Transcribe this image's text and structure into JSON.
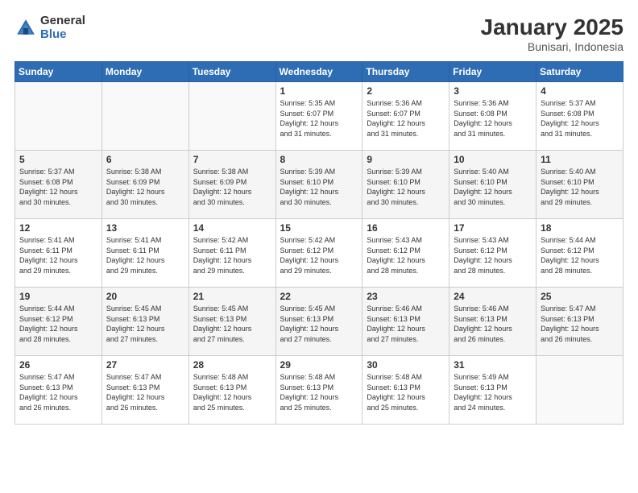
{
  "logo": {
    "general": "General",
    "blue": "Blue"
  },
  "title": "January 2025",
  "subtitle": "Bunisari, Indonesia",
  "headers": [
    "Sunday",
    "Monday",
    "Tuesday",
    "Wednesday",
    "Thursday",
    "Friday",
    "Saturday"
  ],
  "weeks": [
    [
      {
        "num": "",
        "info": ""
      },
      {
        "num": "",
        "info": ""
      },
      {
        "num": "",
        "info": ""
      },
      {
        "num": "1",
        "info": "Sunrise: 5:35 AM\nSunset: 6:07 PM\nDaylight: 12 hours\nand 31 minutes."
      },
      {
        "num": "2",
        "info": "Sunrise: 5:36 AM\nSunset: 6:07 PM\nDaylight: 12 hours\nand 31 minutes."
      },
      {
        "num": "3",
        "info": "Sunrise: 5:36 AM\nSunset: 6:08 PM\nDaylight: 12 hours\nand 31 minutes."
      },
      {
        "num": "4",
        "info": "Sunrise: 5:37 AM\nSunset: 6:08 PM\nDaylight: 12 hours\nand 31 minutes."
      }
    ],
    [
      {
        "num": "5",
        "info": "Sunrise: 5:37 AM\nSunset: 6:08 PM\nDaylight: 12 hours\nand 30 minutes."
      },
      {
        "num": "6",
        "info": "Sunrise: 5:38 AM\nSunset: 6:09 PM\nDaylight: 12 hours\nand 30 minutes."
      },
      {
        "num": "7",
        "info": "Sunrise: 5:38 AM\nSunset: 6:09 PM\nDaylight: 12 hours\nand 30 minutes."
      },
      {
        "num": "8",
        "info": "Sunrise: 5:39 AM\nSunset: 6:10 PM\nDaylight: 12 hours\nand 30 minutes."
      },
      {
        "num": "9",
        "info": "Sunrise: 5:39 AM\nSunset: 6:10 PM\nDaylight: 12 hours\nand 30 minutes."
      },
      {
        "num": "10",
        "info": "Sunrise: 5:40 AM\nSunset: 6:10 PM\nDaylight: 12 hours\nand 30 minutes."
      },
      {
        "num": "11",
        "info": "Sunrise: 5:40 AM\nSunset: 6:10 PM\nDaylight: 12 hours\nand 29 minutes."
      }
    ],
    [
      {
        "num": "12",
        "info": "Sunrise: 5:41 AM\nSunset: 6:11 PM\nDaylight: 12 hours\nand 29 minutes."
      },
      {
        "num": "13",
        "info": "Sunrise: 5:41 AM\nSunset: 6:11 PM\nDaylight: 12 hours\nand 29 minutes."
      },
      {
        "num": "14",
        "info": "Sunrise: 5:42 AM\nSunset: 6:11 PM\nDaylight: 12 hours\nand 29 minutes."
      },
      {
        "num": "15",
        "info": "Sunrise: 5:42 AM\nSunset: 6:12 PM\nDaylight: 12 hours\nand 29 minutes."
      },
      {
        "num": "16",
        "info": "Sunrise: 5:43 AM\nSunset: 6:12 PM\nDaylight: 12 hours\nand 28 minutes."
      },
      {
        "num": "17",
        "info": "Sunrise: 5:43 AM\nSunset: 6:12 PM\nDaylight: 12 hours\nand 28 minutes."
      },
      {
        "num": "18",
        "info": "Sunrise: 5:44 AM\nSunset: 6:12 PM\nDaylight: 12 hours\nand 28 minutes."
      }
    ],
    [
      {
        "num": "19",
        "info": "Sunrise: 5:44 AM\nSunset: 6:12 PM\nDaylight: 12 hours\nand 28 minutes."
      },
      {
        "num": "20",
        "info": "Sunrise: 5:45 AM\nSunset: 6:13 PM\nDaylight: 12 hours\nand 27 minutes."
      },
      {
        "num": "21",
        "info": "Sunrise: 5:45 AM\nSunset: 6:13 PM\nDaylight: 12 hours\nand 27 minutes."
      },
      {
        "num": "22",
        "info": "Sunrise: 5:45 AM\nSunset: 6:13 PM\nDaylight: 12 hours\nand 27 minutes."
      },
      {
        "num": "23",
        "info": "Sunrise: 5:46 AM\nSunset: 6:13 PM\nDaylight: 12 hours\nand 27 minutes."
      },
      {
        "num": "24",
        "info": "Sunrise: 5:46 AM\nSunset: 6:13 PM\nDaylight: 12 hours\nand 26 minutes."
      },
      {
        "num": "25",
        "info": "Sunrise: 5:47 AM\nSunset: 6:13 PM\nDaylight: 12 hours\nand 26 minutes."
      }
    ],
    [
      {
        "num": "26",
        "info": "Sunrise: 5:47 AM\nSunset: 6:13 PM\nDaylight: 12 hours\nand 26 minutes."
      },
      {
        "num": "27",
        "info": "Sunrise: 5:47 AM\nSunset: 6:13 PM\nDaylight: 12 hours\nand 26 minutes."
      },
      {
        "num": "28",
        "info": "Sunrise: 5:48 AM\nSunset: 6:13 PM\nDaylight: 12 hours\nand 25 minutes."
      },
      {
        "num": "29",
        "info": "Sunrise: 5:48 AM\nSunset: 6:13 PM\nDaylight: 12 hours\nand 25 minutes."
      },
      {
        "num": "30",
        "info": "Sunrise: 5:48 AM\nSunset: 6:13 PM\nDaylight: 12 hours\nand 25 minutes."
      },
      {
        "num": "31",
        "info": "Sunrise: 5:49 AM\nSunset: 6:13 PM\nDaylight: 12 hours\nand 24 minutes."
      },
      {
        "num": "",
        "info": ""
      }
    ]
  ]
}
